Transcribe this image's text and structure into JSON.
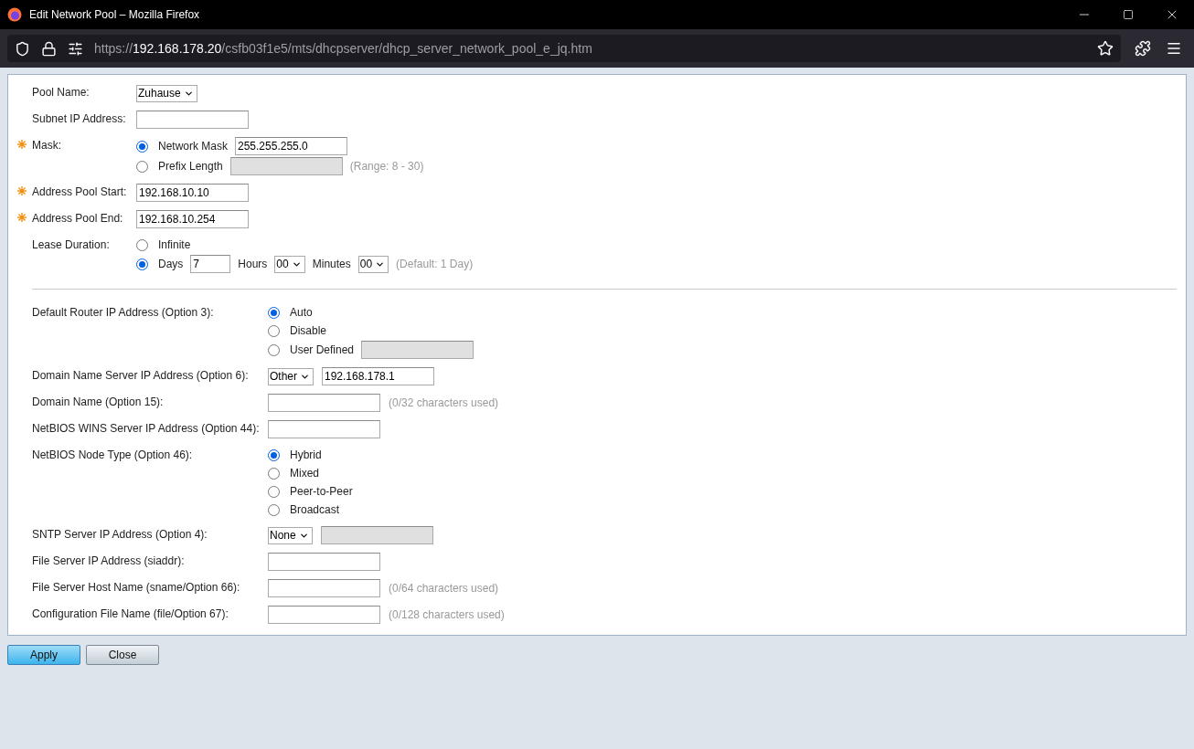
{
  "window": {
    "title": "Edit Network Pool – Mozilla Firefox"
  },
  "address_bar": {
    "scheme": "https://",
    "host": "192.168.178.20",
    "path": "/csfb03f1e5/mts/dhcpserver/dhcp_server_network_pool_e_jq.htm"
  },
  "sections": [
    {
      "kind": "basic",
      "rows": [
        {
          "label": "Pool Name:",
          "required": false,
          "controls": [
            {
              "kind": "select",
              "value": "Zuhause"
            }
          ]
        },
        {
          "label": "Subnet IP Address:",
          "required": false,
          "controls": [
            {
              "kind": "input",
              "disabled": false
            }
          ]
        },
        {
          "label": "Mask:",
          "required": true,
          "controls": [
            {
              "kind": "radios",
              "options": [
                {
                  "label": "Network Mask",
                  "selected": true,
                  "controls": [
                    {
                      "kind": "input",
                      "value": "255.255.255.0",
                      "disabled": false
                    }
                  ]
                },
                {
                  "label": "Prefix Length",
                  "selected": false,
                  "controls": [
                    {
                      "kind": "input",
                      "disabled": true
                    },
                    {
                      "kind": "hint",
                      "text": "(Range: 8 - 30)"
                    }
                  ]
                }
              ]
            }
          ]
        },
        {
          "label": "Address Pool Start:",
          "required": true,
          "controls": [
            {
              "kind": "input",
              "value": "192.168.10.10",
              "disabled": false
            }
          ]
        },
        {
          "label": "Address Pool End:",
          "required": true,
          "controls": [
            {
              "kind": "input",
              "value": "192.168.10.254",
              "disabled": false
            }
          ]
        },
        {
          "label": "Lease Duration:",
          "required": false,
          "controls": [
            {
              "kind": "radios",
              "options": [
                {
                  "label": "Infinite",
                  "selected": false
                },
                {
                  "label": "Days",
                  "selected": true,
                  "controls": [
                    {
                      "kind": "number",
                      "value": "7",
                      "disabled": false
                    },
                    {
                      "kind": "text",
                      "text": "Hours"
                    },
                    {
                      "kind": "select",
                      "value": "00"
                    },
                    {
                      "kind": "text",
                      "text": "Minutes"
                    },
                    {
                      "kind": "select",
                      "value": "00"
                    },
                    {
                      "kind": "hint",
                      "text": "(Default: 1 Day)"
                    }
                  ]
                }
              ]
            }
          ]
        }
      ]
    },
    {
      "kind": "options",
      "rows": [
        {
          "label": "Default Router IP Address (Option 3):",
          "required": false,
          "controls": [
            {
              "kind": "radios",
              "options": [
                {
                  "label": "Auto",
                  "selected": true
                },
                {
                  "label": "Disable",
                  "selected": false
                },
                {
                  "label": "User Defined",
                  "selected": false,
                  "controls": [
                    {
                      "kind": "input",
                      "disabled": true
                    }
                  ]
                }
              ]
            }
          ]
        },
        {
          "label": "Domain Name Server IP Address (Option 6):",
          "required": false,
          "controls": [
            {
              "kind": "select",
              "value": "Other"
            },
            {
              "kind": "input",
              "value": "192.168.178.1",
              "disabled": false
            }
          ]
        },
        {
          "label": "Domain Name (Option 15):",
          "required": false,
          "controls": [
            {
              "kind": "input",
              "disabled": false
            },
            {
              "kind": "hint",
              "text": "(0/32 characters used)"
            }
          ]
        },
        {
          "label": "NetBIOS WINS Server IP Address (Option 44):",
          "required": false,
          "controls": [
            {
              "kind": "input",
              "disabled": false
            }
          ]
        },
        {
          "label": "NetBIOS Node Type (Option 46):",
          "required": false,
          "controls": [
            {
              "kind": "radios",
              "options": [
                {
                  "label": "Hybrid",
                  "selected": true
                },
                {
                  "label": "Mixed",
                  "selected": false
                },
                {
                  "label": "Peer-to-Peer",
                  "selected": false
                },
                {
                  "label": "Broadcast",
                  "selected": false
                }
              ]
            }
          ]
        },
        {
          "label": "SNTP Server IP Address (Option 4):",
          "required": false,
          "controls": [
            {
              "kind": "select",
              "value": "None"
            },
            {
              "kind": "input",
              "disabled": true
            }
          ]
        },
        {
          "label": "File Server IP Address (siaddr):",
          "required": false,
          "controls": [
            {
              "kind": "input",
              "disabled": false
            }
          ]
        },
        {
          "label": "File Server Host Name (sname/Option 66):",
          "required": false,
          "controls": [
            {
              "kind": "input",
              "disabled": false
            },
            {
              "kind": "hint",
              "text": "(0/64 characters used)"
            }
          ]
        },
        {
          "label": "Configuration File Name (file/Option 67):",
          "required": false,
          "controls": [
            {
              "kind": "input",
              "disabled": false
            },
            {
              "kind": "hint",
              "text": "(0/128 characters used)"
            }
          ]
        }
      ]
    }
  ],
  "buttons": [
    {
      "label": "Apply",
      "kind": "primary"
    },
    {
      "label": "Close",
      "kind": "secondary"
    }
  ]
}
